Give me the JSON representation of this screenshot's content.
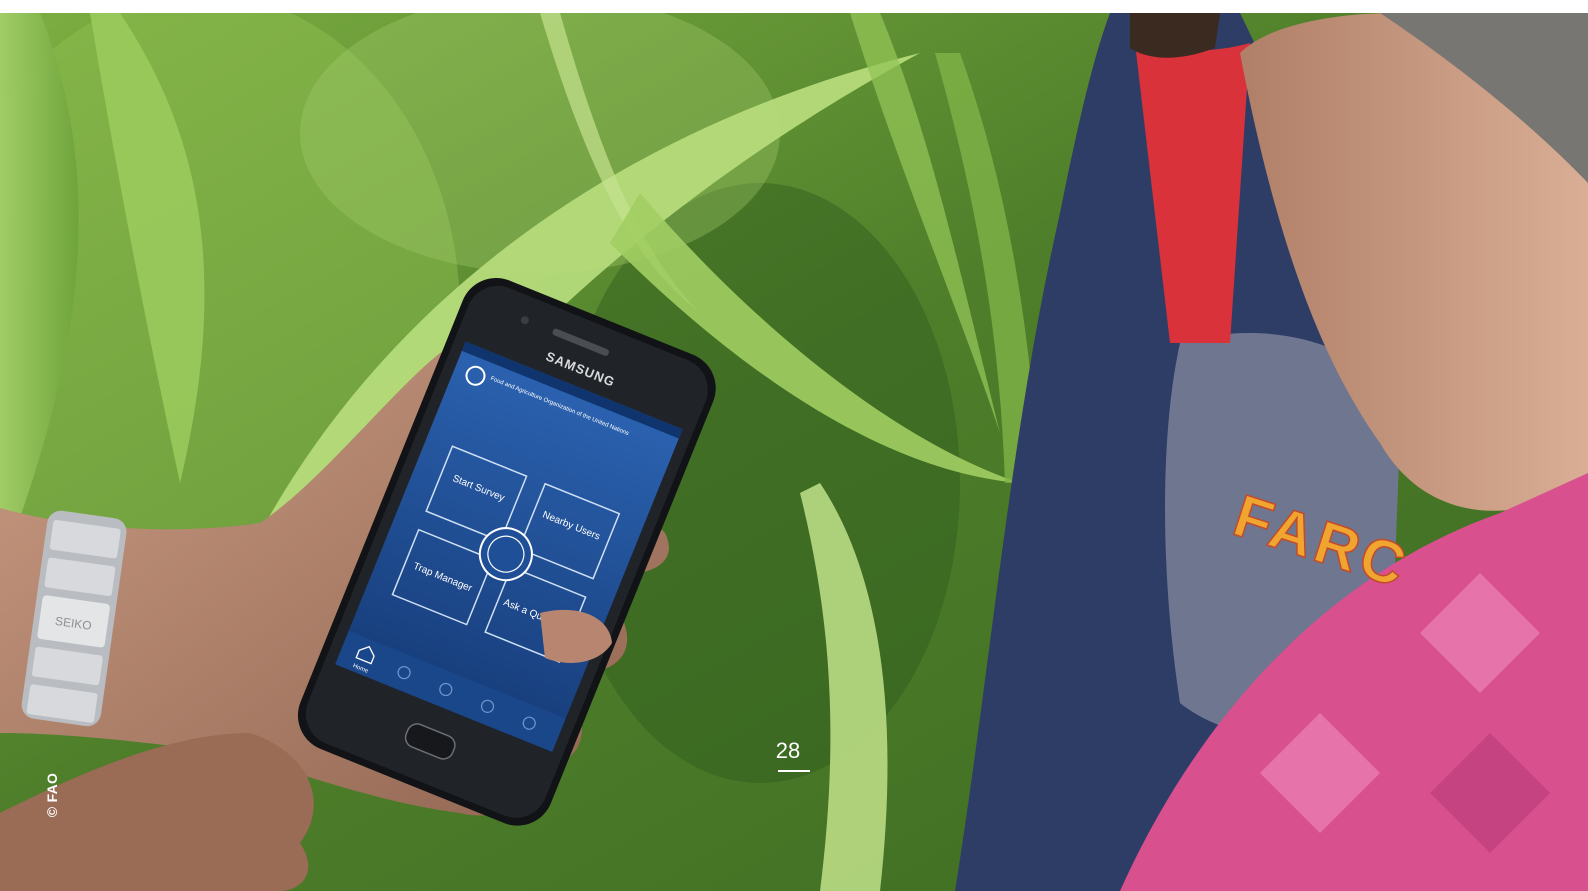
{
  "photo": {
    "credit": "© FAO",
    "phone_brand": "SAMSUNG",
    "app_header": "Food and Agriculture Organization of the United Nations",
    "app_tiles": [
      {
        "label": "Start Survey"
      },
      {
        "label": "Nearby Users"
      },
      {
        "label": "Trap Manager"
      },
      {
        "label": "Ask a Question"
      }
    ],
    "app_nav_first": "Home",
    "watch_brand": "SEIKO",
    "shirt_text": "FARC",
    "colors": {
      "foliage": "#6fa83a",
      "phone_screen": "#1f4f97",
      "jacket": "#2e3d66",
      "collar": "#d9323a",
      "shirt": "#d8508e",
      "text": "#ffffff"
    }
  },
  "page": {
    "number": "28"
  }
}
